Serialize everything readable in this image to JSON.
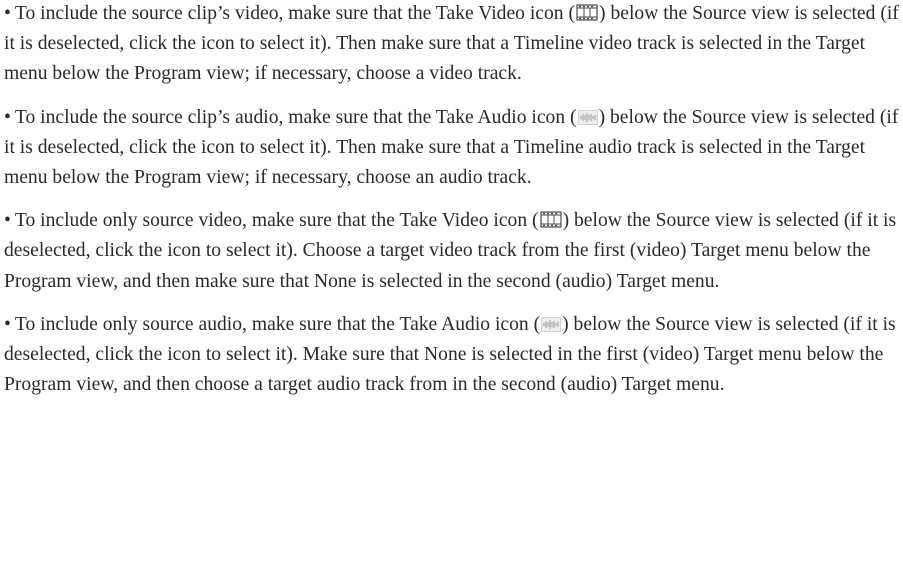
{
  "document": {
    "bullet_char": "•",
    "paragraphs": [
      {
        "before_icon": "To include the source clip’s video, make sure that the Take Video icon (",
        "icon": "take-video-icon",
        "after_icon": ") below the Source view is selected (if it is deselected, click the icon to select it). Then make sure that a Timeline video track is selected in the Target menu below the Program view; if necessary, choose a video track."
      },
      {
        "before_icon": "To include the source clip’s audio, make sure that the Take Audio icon (",
        "icon": "take-audio-icon",
        "after_icon": ") below the Source view is selected (if it is deselected, click the icon to select it). Then make sure that a Timeline audio track is selected in the Target menu below the Program view; if necessary, choose an audio track."
      },
      {
        "before_icon": "To include only source video, make sure that the Take Video icon (",
        "icon": "take-video-icon",
        "after_icon": ") below the Source view is selected (if it is deselected, click the icon to select it). Choose a target video track from the first (video) Target menu below the Program view, and then make sure that None is selected in the second (audio) Target menu."
      },
      {
        "before_icon": "To include only source audio, make sure that the Take Audio icon (",
        "icon": "take-audio-icon",
        "after_icon": ") below the Source view is selected (if it is deselected, click the icon to select it). Make sure that None is selected in the first (video) Target menu below the Program view, and then choose a target audio track from in the second (audio) Target menu."
      }
    ]
  }
}
